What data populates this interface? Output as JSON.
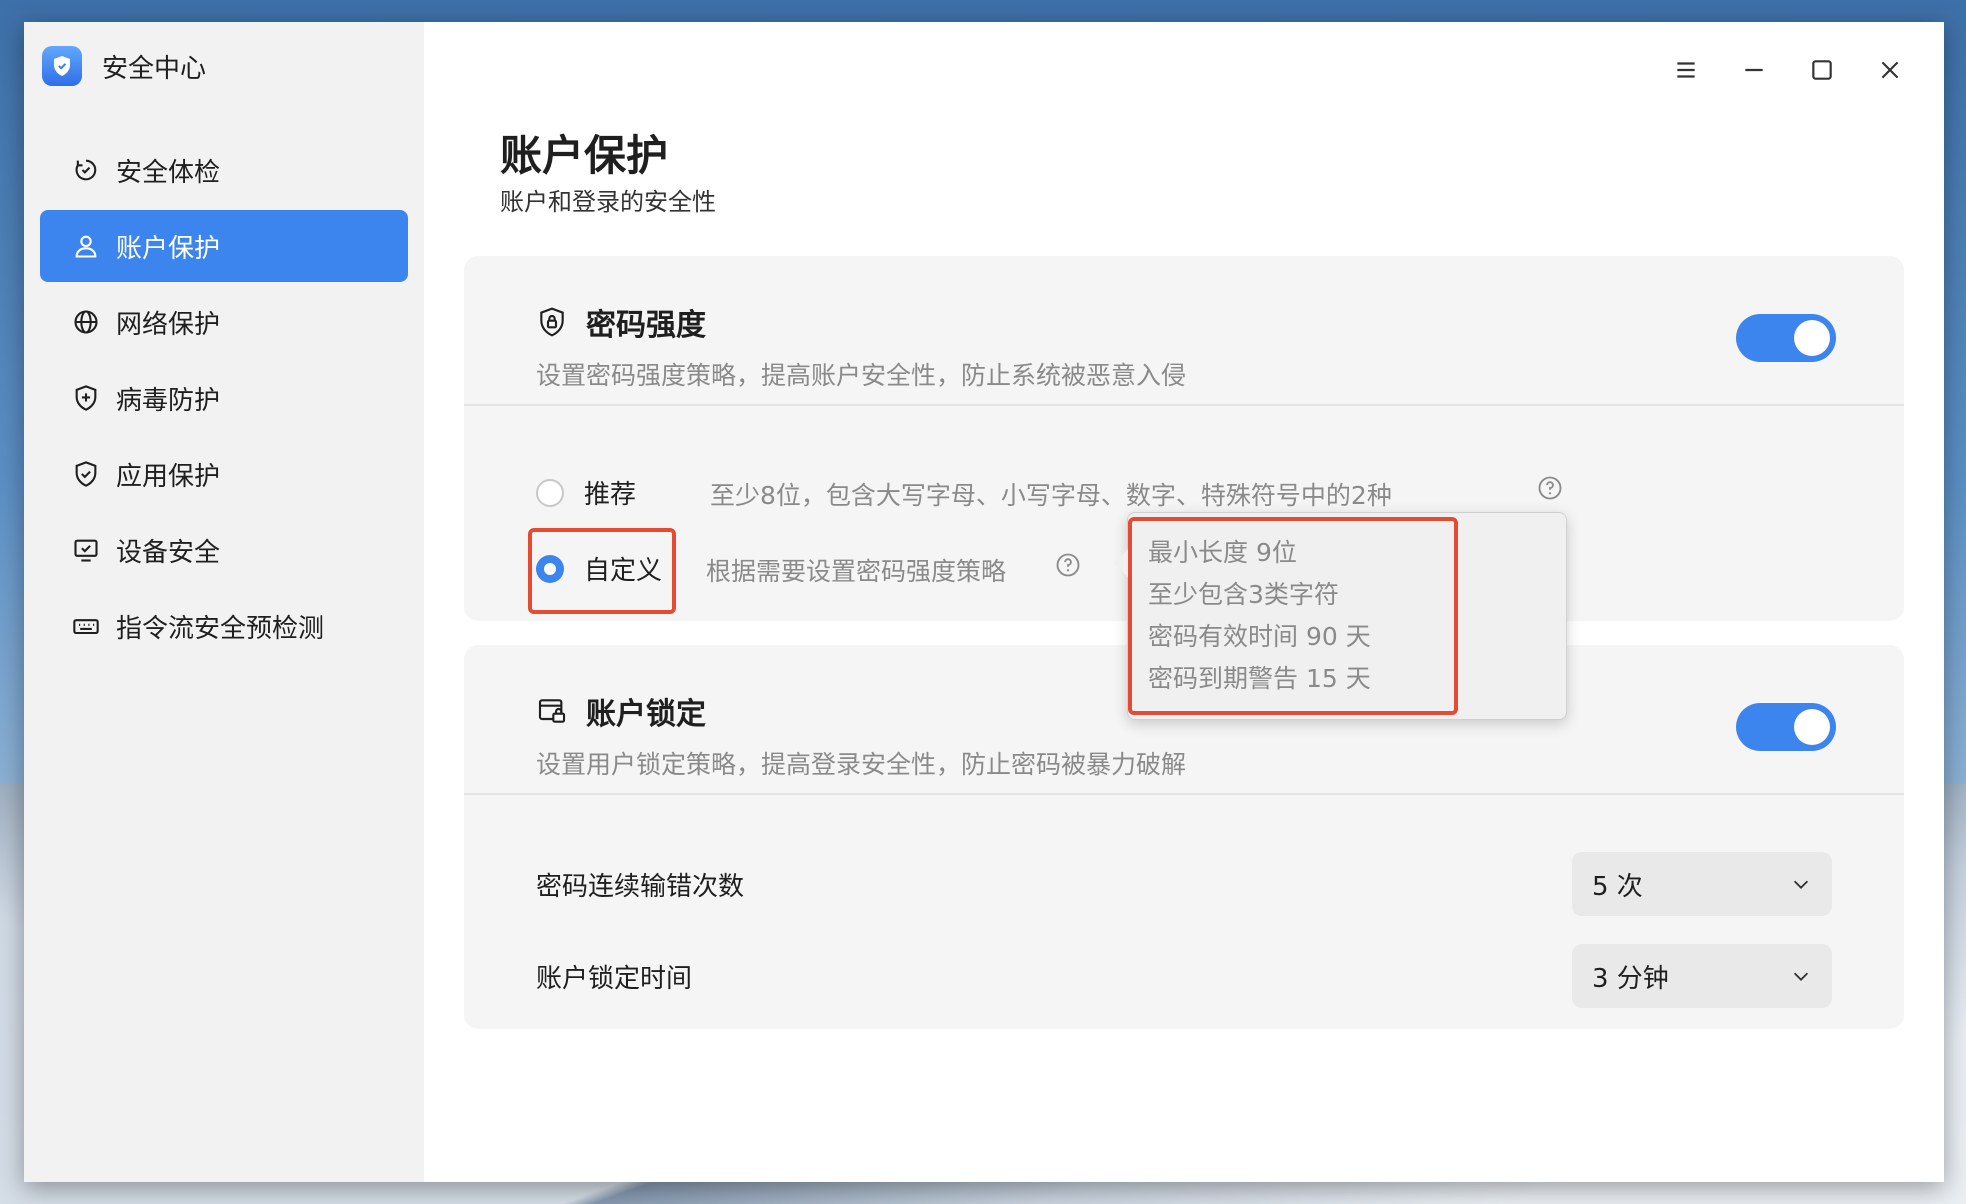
{
  "app": {
    "title": "安全中心"
  },
  "sidebar": {
    "items": [
      {
        "label": "安全体检",
        "icon": "refresh-check-icon"
      },
      {
        "label": "账户保护",
        "icon": "user-icon",
        "active": true
      },
      {
        "label": "网络保护",
        "icon": "globe-icon"
      },
      {
        "label": "病毒防护",
        "icon": "shield-plus-icon"
      },
      {
        "label": "应用保护",
        "icon": "shield-check-icon"
      },
      {
        "label": "设备安全",
        "icon": "monitor-check-icon"
      },
      {
        "label": "指令流安全预检测",
        "icon": "keyboard-icon"
      }
    ]
  },
  "window_controls": [
    "menu-icon",
    "minimize-icon",
    "maximize-icon",
    "close-icon"
  ],
  "page": {
    "title": "账户保护",
    "subtitle": "账户和登录的安全性"
  },
  "password_strength": {
    "title": "密码强度",
    "description": "设置密码强度策略，提高账户安全性，防止系统被恶意入侵",
    "enabled": true,
    "options": [
      {
        "label": "推荐",
        "description": "至少8位，包含大写字母、小写字母、数字、特殊符号中的2种",
        "selected": false
      },
      {
        "label": "自定义",
        "description": "根据需要设置密码强度策略",
        "selected": true
      }
    ],
    "tooltip": [
      "最小长度 9位",
      "至少包含3类字符",
      "密码有效时间 90 天",
      "密码到期警告 15 天"
    ]
  },
  "account_lock": {
    "title": "账户锁定",
    "description": "设置用户锁定策略，提高登录安全性，防止密码被暴力破解",
    "enabled": true,
    "fields": [
      {
        "label": "密码连续输错次数",
        "value": "5 次"
      },
      {
        "label": "账户锁定时间",
        "value": "3 分钟"
      }
    ]
  },
  "colors": {
    "accent": "#3d85ee",
    "highlight": "#e54b33"
  }
}
